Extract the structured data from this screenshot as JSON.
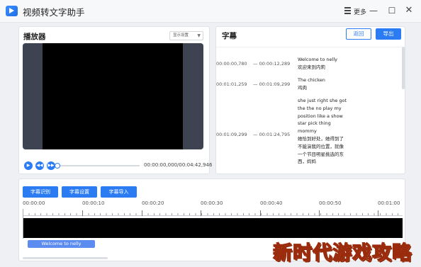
{
  "app": {
    "title": "视频转文字助手",
    "more_label": "更多",
    "window_controls": {
      "minimize": "—",
      "maximize": "☐",
      "close": "✕"
    }
  },
  "player": {
    "title": "播放器",
    "display_select": "显示设置",
    "time_readout": "00:00:00,000/00:04:42,946",
    "progress_fraction": 0.0,
    "icons": {
      "play": "play-icon",
      "prev": "rewind-icon",
      "next": "fast-forward-icon"
    }
  },
  "subtitles": {
    "title": "字幕",
    "back_label": "返回",
    "export_label": "导出",
    "separator": "—",
    "rows": [
      {
        "start": "00:00:00,780",
        "end": "00:00:12,289",
        "text": "Welcome to nelly\n欢迎来到内莉"
      },
      {
        "start": "00:01:01,259",
        "end": "00:01:09,299",
        "text": "The chicken\n鸡肉"
      },
      {
        "start": "00:01:09,299",
        "end": "00:01:24,795",
        "text": " she just right she got the the no play my position like a show star pick thing mommy\n她恰到好处，她得到了不能演我的位置，就像一个节目明星挑选的东西，妈妈"
      }
    ]
  },
  "timeline": {
    "buttons": {
      "recognize": "字幕识别",
      "settings": "字幕设置",
      "import": "字幕导入"
    },
    "ruler_labels": [
      "00:00:00",
      "00:00:10",
      "00:00:20",
      "00:00:30",
      "00:00:40",
      "00:00:50",
      "00:01:00"
    ],
    "clip_label": "Welcome to nelly"
  },
  "watermark": "新时代游戏攻略",
  "colors": {
    "accent": "#2b7cf2",
    "video_bg": "#3d4350"
  }
}
